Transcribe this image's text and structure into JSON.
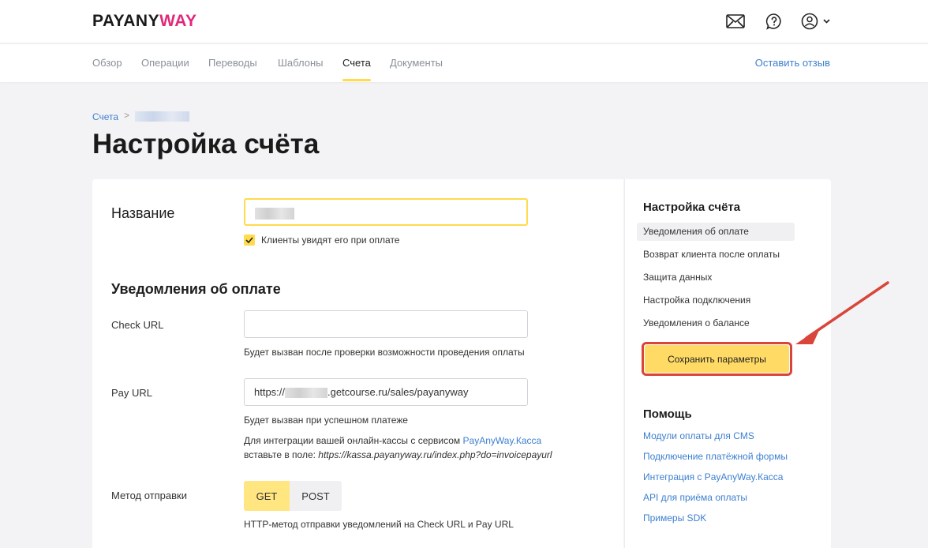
{
  "header": {
    "logo": {
      "part1": "PAYANY",
      "part2": "WAY"
    },
    "icons": [
      "mail-icon",
      "help-icon",
      "user-icon"
    ]
  },
  "nav": {
    "items": [
      "Обзор",
      "Операции",
      "Переводы",
      "Шаблоны",
      "Счета",
      "Документы"
    ],
    "active": "Счета",
    "feedback": "Оставить отзыв"
  },
  "breadcrumb": {
    "root": "Счета",
    "separator": ">"
  },
  "page": {
    "title": "Настройка счёта"
  },
  "form": {
    "name_label": "Название",
    "name_checkbox_label": "Клиенты увидят его при оплате",
    "notifications_title": "Уведомления об оплате",
    "check_url": {
      "label": "Check URL",
      "value": "",
      "hint": "Будет вызван после проверки возможности проведения оплаты"
    },
    "pay_url": {
      "label": "Pay URL",
      "value_prefix": "https://",
      "value_suffix": ".getcourse.ru/sales/payanyway",
      "hint": "Будет вызван при успешном платеже",
      "integration_text": "Для интеграции вашей онлайн-кассы с сервисом ",
      "integration_link": "PayAnyWay.Касса",
      "insert_text": "вставьте в поле: ",
      "insert_url": "https://kassa.payanyway.ru/index.php?do=invoicepayurl"
    },
    "method": {
      "label": "Метод отправки",
      "options": [
        "GET",
        "POST"
      ],
      "selected": "GET",
      "hint": "HTTP-метод отправки уведомлений на Check URL и Pay URL"
    }
  },
  "sidebar": {
    "title": "Настройка счёта",
    "items": [
      "Уведомления об оплате",
      "Возврат клиента после оплаты",
      "Защита данных",
      "Настройка подключения",
      "Уведомления о балансе"
    ],
    "active_index": 0,
    "save_button": "Сохранить параметры",
    "help_title": "Помощь",
    "help_links": [
      "Модули оплаты для CMS",
      "Подключение платёжной формы",
      "Интеграция с PayAnyWay.Касса",
      "API для приёма оплаты",
      "Примеры SDK"
    ]
  },
  "colors": {
    "accent_yellow": "#ffdb4d",
    "link_blue": "#3d7fcf",
    "annotation_red": "#d9453a",
    "logo_pink": "#e0297a"
  }
}
